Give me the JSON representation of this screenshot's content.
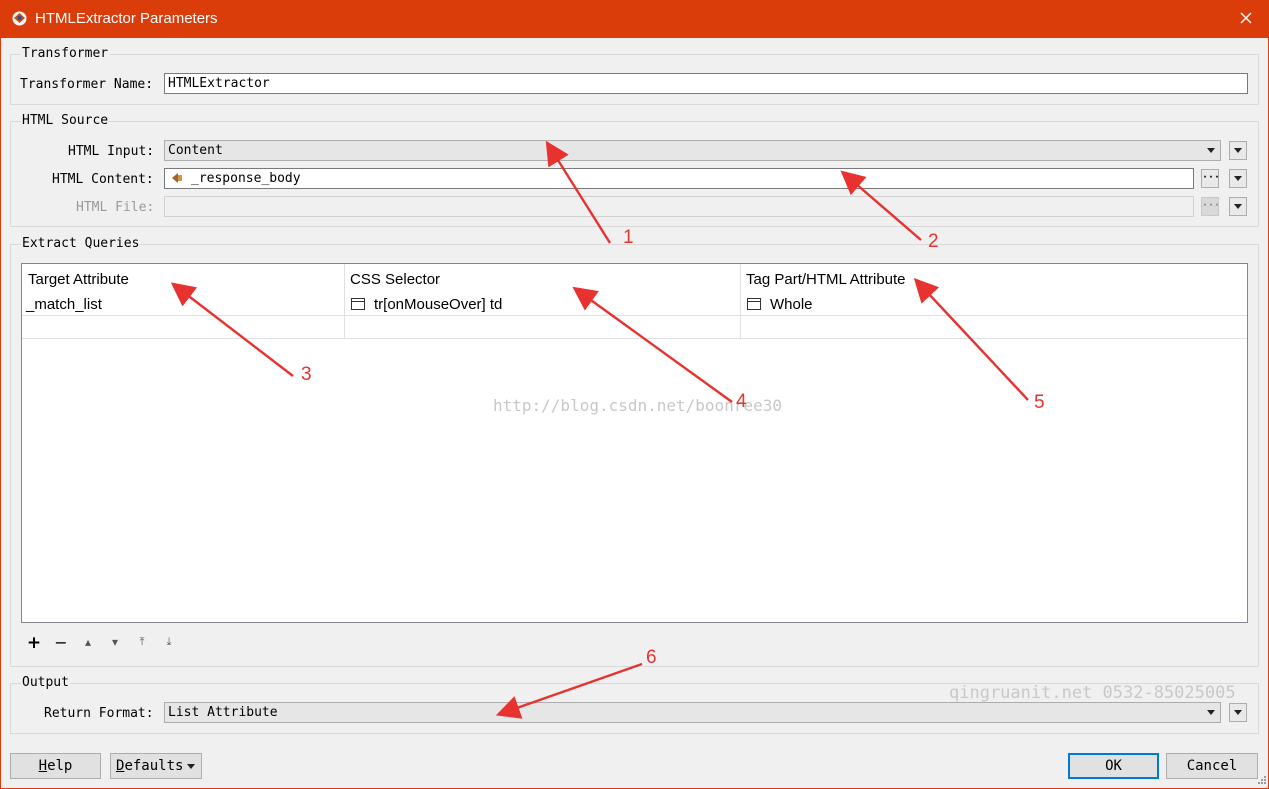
{
  "window": {
    "title": "HTMLExtractor Parameters"
  },
  "transformer": {
    "group_title": "Transformer",
    "name_label": "Transformer Name:",
    "name_value": "HTMLExtractor"
  },
  "html_source": {
    "group_title": "HTML Source",
    "input_label": "HTML Input:",
    "input_value": "Content",
    "content_label": "HTML Content:",
    "content_value": "_response_body",
    "file_label": "HTML File:",
    "file_value": ""
  },
  "extract_queries": {
    "group_title": "Extract Queries",
    "columns": [
      "Target Attribute",
      "CSS Selector",
      "Tag Part/HTML Attribute"
    ],
    "rows": [
      {
        "target": "_match_list",
        "selector": "tr[onMouseOver] td",
        "tag_part": "Whole"
      }
    ],
    "toolbar": {
      "add": "+",
      "remove": "−",
      "up": "▴",
      "down": "▾",
      "top": "⤒",
      "bottom": "⤓"
    }
  },
  "watermark_center": "http://blog.csdn.net/boonree30",
  "output": {
    "group_title": "Output",
    "return_label": "Return Format:",
    "return_value": "List Attribute"
  },
  "watermark_right": "qingruanit.net 0532-85025005",
  "buttons": {
    "help_first": "H",
    "help_rest": "elp",
    "defaults_first": "D",
    "defaults_rest": "efaults",
    "ok": "OK",
    "cancel": "Cancel"
  },
  "annotations": [
    "1",
    "2",
    "3",
    "4",
    "5",
    "6"
  ],
  "colors": {
    "titlebar": "#db3d0a",
    "arrow": "#e8322f",
    "primary_border": "#0078d7"
  },
  "icons": {
    "app": "fme-transformer-icon",
    "close": "close-icon",
    "attribute": "attribute-source-icon",
    "cell": "cell-type-icon"
  }
}
